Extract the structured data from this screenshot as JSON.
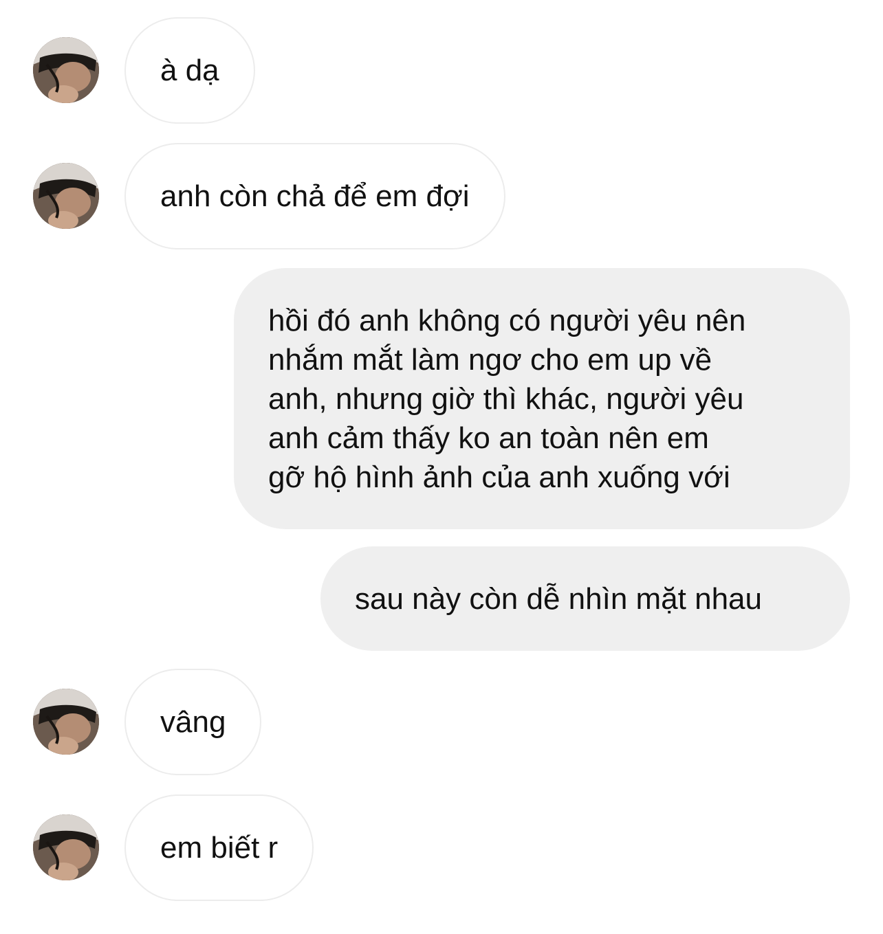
{
  "conversation": {
    "messages": [
      {
        "direction": "incoming",
        "text": "à dạ"
      },
      {
        "direction": "incoming",
        "text": "anh còn chả để em đợi"
      },
      {
        "direction": "outgoing",
        "text": "hồi đó anh không có người yêu nên\nnhắm mắt làm ngơ cho em up về\nanh, nhưng giờ thì khác, người yêu\nanh cảm thấy ko an toàn nên em\ngỡ hộ hình ảnh của anh xuống với"
      },
      {
        "direction": "outgoing",
        "text": "sau này còn dễ nhìn mặt nhau"
      },
      {
        "direction": "incoming",
        "text": "vâng"
      },
      {
        "direction": "incoming",
        "text": "em biết r"
      }
    ]
  },
  "colors": {
    "outgoing_bubble": "#efefef",
    "incoming_border": "#ececec",
    "text": "#111111"
  }
}
